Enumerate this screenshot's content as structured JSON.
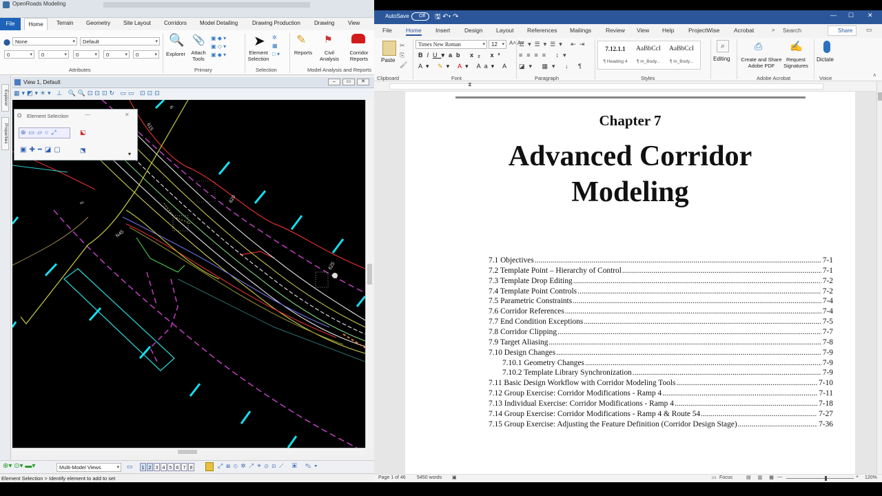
{
  "openroads": {
    "title": "OpenRoads Modeling",
    "tabs": [
      "File",
      "Home",
      "Terrain",
      "Geometry",
      "Site Layout",
      "Corridors",
      "Model Detailing",
      "Drawing Production",
      "Drawing",
      "View"
    ],
    "ribbon": {
      "level_value": "None",
      "style_value": "Default",
      "num_values": [
        "0",
        "0",
        "0",
        "0",
        "0"
      ],
      "buttons": {
        "explorer": "Explorer",
        "attach_tools": "Attach\nTools",
        "element_selection": "Element\nSelection",
        "reports": "Reports",
        "civil_analysis": "Civil\nAnalysis",
        "corridor_reports": "Corridor\nReports"
      },
      "groups": {
        "attributes": "Attributes",
        "primary": "Primary",
        "selection": "Selection",
        "model_analysis": "Model Analysis and Reports"
      }
    },
    "side_tabs": [
      "Explorer",
      "Properties"
    ],
    "view_title": "View 1, Default",
    "element_selection_title": "Element Selection",
    "canvas_labels": [
      "615",
      "620",
      "625",
      "5",
      "6",
      "N45"
    ],
    "bottom": {
      "view_set": "Multi-Model Views",
      "view_numbers": [
        "1",
        "2",
        "3",
        "4",
        "5",
        "6",
        "7",
        "8"
      ]
    },
    "status": "Element Selection > Identify element to add to set"
  },
  "word": {
    "autosave_label": "AutoSave",
    "autosave_state": "Off",
    "tabs": [
      "File",
      "Home",
      "Insert",
      "Design",
      "Layout",
      "References",
      "Mailings",
      "Review",
      "View",
      "Help",
      "ProjectWise",
      "Acrobat"
    ],
    "search_label": "Search",
    "share_label": "Share",
    "ribbon": {
      "paste_label": "Paste",
      "font_name": "Times New Roman",
      "font_size": "12",
      "styles": [
        {
          "preview": "7.12.1.1",
          "name": "¶ Heading 4"
        },
        {
          "preview": "AaBbCcI",
          "name": "¶ m_Body..."
        },
        {
          "preview": "AaBbCcI",
          "name": "¶ m_Body..."
        }
      ],
      "editing_label": "Editing",
      "create_share_pdf": "Create and Share\nAdobe PDF",
      "request_signatures": "Request\nSignatures",
      "dictate_label": "Dictate",
      "groups": {
        "clipboard": "Clipboard",
        "font": "Font",
        "paragraph": "Paragraph",
        "styles": "Styles",
        "adobe": "Adobe Acrobat",
        "voice": "Voice"
      }
    },
    "document": {
      "chapter": "Chapter 7",
      "title_line1": "Advanced Corridor",
      "title_line2": "Modeling",
      "toc": [
        {
          "text": "7.1 Objectives",
          "page": "7-1",
          "indent": 0
        },
        {
          "text": "7.2 Template Point – Hierarchy of Control",
          "page": "7-1",
          "indent": 0
        },
        {
          "text": "7.3 Template Drop Editing",
          "page": "7-2",
          "indent": 0
        },
        {
          "text": "7.4 Template Point Controls",
          "page": "7-2",
          "indent": 0
        },
        {
          "text": "7.5 Parametric Constraints",
          "page": "7-4",
          "indent": 0
        },
        {
          "text": "7.6 Corridor References",
          "page": "7-4",
          "indent": 0
        },
        {
          "text": "7.7 End Condition Exceptions",
          "page": "7-5",
          "indent": 0
        },
        {
          "text": "7.8 Corridor Clipping",
          "page": "7-7",
          "indent": 0
        },
        {
          "text": "7.9 Target Aliasing",
          "page": "7-8",
          "indent": 0
        },
        {
          "text": "7.10 Design Changes",
          "page": "7-9",
          "indent": 0
        },
        {
          "text": "7.10.1 Geometry Changes",
          "page": "7-9",
          "indent": 1
        },
        {
          "text": "7.10.2 Template Library Synchronization",
          "page": "7-9",
          "indent": 1
        },
        {
          "text": "7.11 Basic Design Workflow with Corridor Modeling Tools",
          "page": "7-10",
          "indent": 0
        },
        {
          "text": "7.12 Group Exercise: Corridor Modifications - Ramp 4",
          "page": "7-11",
          "indent": 0
        },
        {
          "text": "7.13 Individual Exercise: Corridor Modifications - Ramp 4",
          "page": "7-18",
          "indent": 0
        },
        {
          "text": "7.14 Group Exercise: Corridor Modifications - Ramp 4 & Route 54",
          "page": "7-27",
          "indent": 0
        },
        {
          "text": "7.15 Group Exercise: Adjusting the Feature Definition (Corridor Design Stage)",
          "page": "7-36",
          "indent": 0
        }
      ]
    },
    "status": {
      "page": "Page 1 of 46",
      "words": "5450 words",
      "focus": "Focus",
      "zoom": "120%"
    }
  },
  "colors": {
    "word_blue": "#2b579a",
    "ribbon_file": "#1e63b8",
    "cad_bg": "#000000",
    "cyan_marks": "#16e0f0",
    "magenta_dash": "#c040c0"
  }
}
